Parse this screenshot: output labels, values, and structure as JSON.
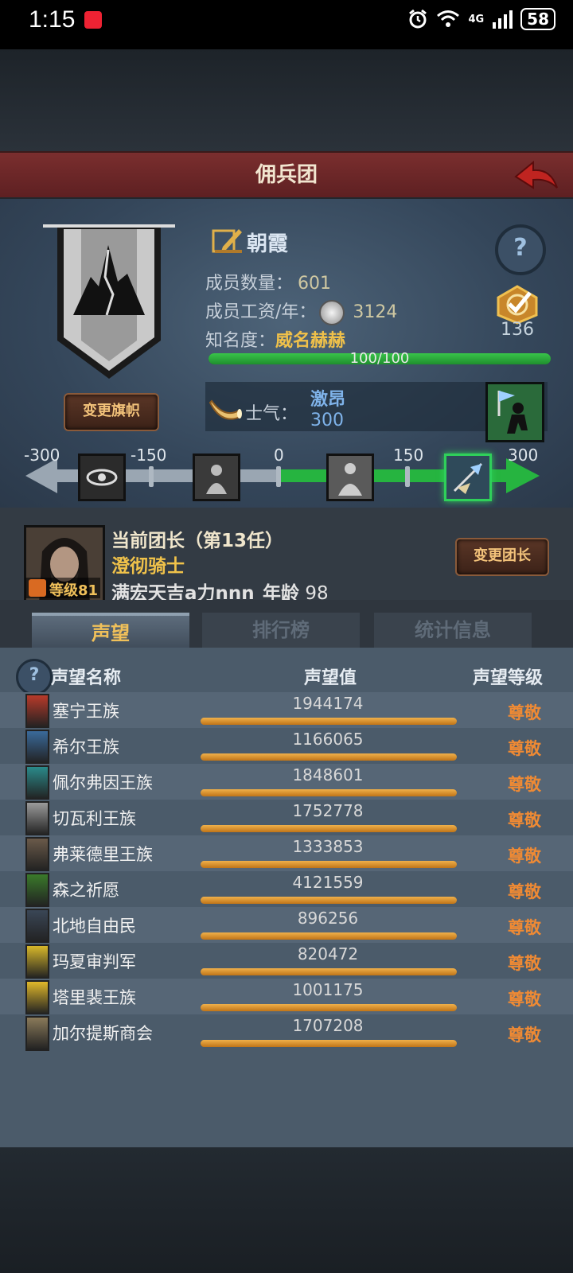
{
  "status": {
    "time": "1:15",
    "battery": "58",
    "network": "4G"
  },
  "header": {
    "title": "佣兵团"
  },
  "guild": {
    "name": "朝霞",
    "members_label": "成员数量：",
    "members_value": "601",
    "wage_label": "成员工资/年：",
    "wage_value": "3124",
    "fame_label": "知名度：",
    "fame_value": "威名赫赫",
    "fame_progress": "100/100",
    "fame_fraction": 1.0,
    "target_count": "136",
    "change_banner_label": "变更旗帜",
    "morale_label": "士气：",
    "morale_state": "激昂",
    "morale_value": "300"
  },
  "morale_scale": {
    "ticks": [
      "-300",
      "-150",
      "0",
      "150",
      "300"
    ],
    "current": 300
  },
  "leader": {
    "title": "当前团长（第13任）",
    "class": "澄彻骑士",
    "name": "满宏天吉a力nnn",
    "age_label": "年龄",
    "age": "98",
    "level_label": "等级81",
    "change_label": "变更团长"
  },
  "tabs": [
    "声望",
    "排行榜",
    "统计信息"
  ],
  "table": {
    "col_name": "声望名称",
    "col_value": "声望值",
    "col_level": "声望等级",
    "rows": [
      {
        "name": "塞宁王族",
        "value": "1944174",
        "level": "尊敬",
        "color": "#b83a2a"
      },
      {
        "name": "希尔王族",
        "value": "1166065",
        "level": "尊敬",
        "color": "#3a6a9a"
      },
      {
        "name": "佩尔弗因王族",
        "value": "1848601",
        "level": "尊敬",
        "color": "#2a8a8a"
      },
      {
        "name": "切瓦利王族",
        "value": "1752778",
        "level": "尊敬",
        "color": "#9a9a9a"
      },
      {
        "name": "弗莱德里王族",
        "value": "1333853",
        "level": "尊敬",
        "color": "#6a5a4a"
      },
      {
        "name": "森之祈愿",
        "value": "4121559",
        "level": "尊敬",
        "color": "#3a7a2a"
      },
      {
        "name": "北地自由民",
        "value": "896256",
        "level": "尊敬",
        "color": "#3a4656"
      },
      {
        "name": "玛夏审判军",
        "value": "820472",
        "level": "尊敬",
        "color": "#d8b82a"
      },
      {
        "name": "塔里裴王族",
        "value": "1001175",
        "level": "尊敬",
        "color": "#e0b82a"
      },
      {
        "name": "加尔提斯商会",
        "value": "1707208",
        "level": "尊敬",
        "color": "#8a7a5a"
      }
    ]
  }
}
